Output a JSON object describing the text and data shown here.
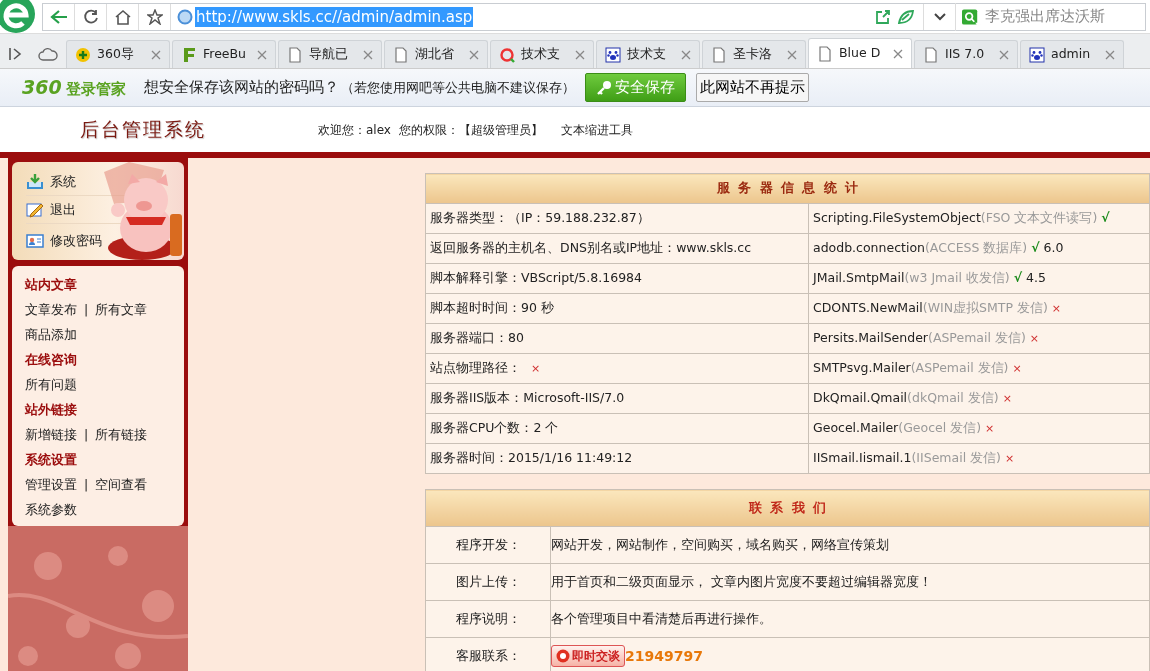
{
  "browser": {
    "url": "http://www.skls.cc//admin/admin.asp",
    "search": {
      "placeholder": "李克强出席达沃斯"
    }
  },
  "tabs": [
    {
      "title": "360导",
      "selected": false
    },
    {
      "title": "FreeBu",
      "selected": false
    },
    {
      "title": "导航已",
      "selected": false
    },
    {
      "title": "湖北省",
      "selected": false
    },
    {
      "title": "技术支",
      "selected": false
    },
    {
      "title": "技术支",
      "selected": false
    },
    {
      "title": "圣卡洛",
      "selected": false
    },
    {
      "title": "Blue D",
      "selected": true
    },
    {
      "title": "IIS 7.0",
      "selected": false
    },
    {
      "title": "admin",
      "selected": false
    }
  ],
  "password_bar": {
    "brand_number": "360",
    "brand": "登录管家",
    "message": "想安全保存该网站的密码吗？",
    "note": "（若您使用网吧等公共电脑不建议保存）",
    "save_button": "安全保存",
    "dismiss_button": "此网站不再提示"
  },
  "header": {
    "title": "后台管理系统",
    "welcome": "欢迎您：alex  您的权限：【超级管理员】",
    "link": "文本缩进工具"
  },
  "quick_menu": [
    {
      "label": "系统"
    },
    {
      "label": "退出"
    },
    {
      "label": "修改密码"
    }
  ],
  "nav_sections": [
    {
      "title": "站内文章",
      "rows": [
        {
          "links": [
            "文章发布",
            "所有文章"
          ],
          "separator": "|"
        },
        {
          "links": [
            "商品添加"
          ]
        }
      ]
    },
    {
      "title": "在线咨询",
      "rows": [
        {
          "links": [
            "所有问题"
          ]
        }
      ]
    },
    {
      "title": "站外链接",
      "rows": [
        {
          "links": [
            "新增链接",
            "所有链接"
          ],
          "separator": "|"
        }
      ]
    },
    {
      "title": "系统设置",
      "rows": [
        {
          "links": [
            "管理设置",
            "空间查看"
          ],
          "separator": "|"
        },
        {
          "links": [
            "系统参数"
          ]
        }
      ]
    }
  ],
  "server_info": {
    "title": "服 务 器 信 息 统 计",
    "rows": [
      {
        "label": "服务器类型：",
        "value": "（IP：59.188.232.87）",
        "component": "Scripting.FileSystemObject",
        "note": "(FSO 文本文件读写)",
        "mark": "√",
        "supported": true
      },
      {
        "label": "返回服务器的主机名、DNS别名或IP地址：",
        "value": "www.skls.cc",
        "component": "adodb.connection",
        "note": "(ACCESS 数据库)",
        "mark": "√",
        "supported": true,
        "version": "6.0"
      },
      {
        "label": "脚本解释引擎：",
        "value": "VBScript/5.8.16984",
        "component": "JMail.SmtpMail",
        "note": "(w3 Jmail 收发信)",
        "mark": "√",
        "supported": true,
        "version": "4.5"
      },
      {
        "label": "脚本超时时间：",
        "value": "90 秒",
        "component": "CDONTS.NewMail",
        "note": "(WIN虚拟SMTP 发信)",
        "mark": "×",
        "supported": false
      },
      {
        "label": "服务器端口：",
        "value": "80",
        "component": "Persits.MailSender",
        "note": "(ASPemail 发信)",
        "mark": "×",
        "supported": false
      },
      {
        "label": "站点物理路径：",
        "flag": "×",
        "component": "SMTPsvg.Mailer",
        "note": "(ASPemail 发信)",
        "mark": "×",
        "supported": false
      },
      {
        "label": "服务器IIS版本：",
        "value": "Microsoft-IIS/7.0",
        "component": "DkQmail.Qmail",
        "note": "(dkQmail 发信)",
        "mark": "×",
        "supported": false
      },
      {
        "label": "服务器CPU个数：",
        "value": "2 个",
        "component": "Geocel.Mailer",
        "note": "(Geocel 发信)",
        "mark": "×",
        "supported": false
      },
      {
        "label": "服务器时间：",
        "value": "2015/1/16 11:49:12",
        "component": "IISmail.Iismail.1",
        "note": "(IISemail 发信)",
        "mark": "×",
        "supported": false
      }
    ]
  },
  "contact": {
    "title": "联 系 我 们",
    "rows": [
      {
        "label": "程序开发：",
        "value": "网站开发，网站制作，空间购买，域名购买，网络宣传策划"
      },
      {
        "label": "图片上传：",
        "value": "用于首页和二级页面显示， 文章内图片宽度不要超过编辑器宽度！"
      },
      {
        "label": "程序说明：",
        "value": "各个管理项目中看清楚后再进行操作。"
      },
      {
        "label": "客服联系：",
        "chat_button": "即时交谈",
        "qq": "21949797"
      }
    ]
  }
}
